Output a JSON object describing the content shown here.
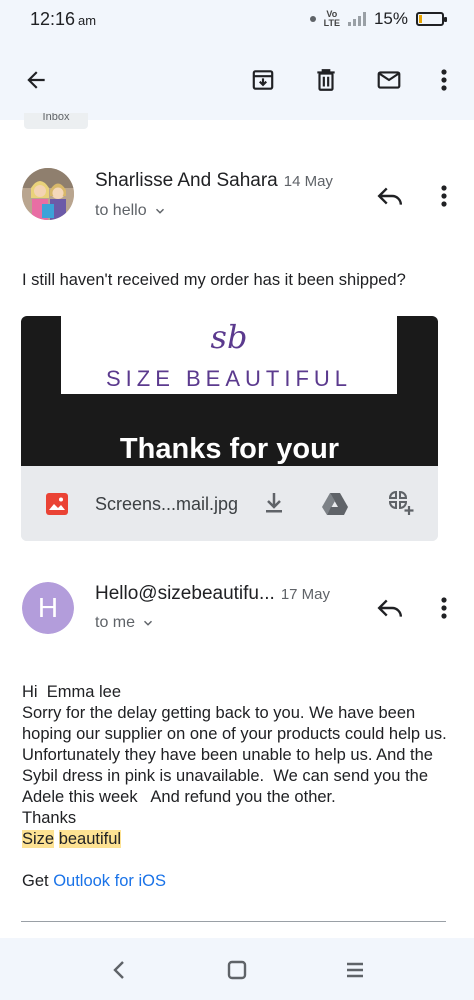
{
  "status_bar": {
    "time": "12:16",
    "ampm": "am",
    "network": "Vo LTE",
    "battery_text": "15%",
    "battery_level": 0.15
  },
  "toolbar": {
    "icons": [
      "back-arrow-icon",
      "archive-icon",
      "delete-icon",
      "mark-unread-icon",
      "more-vert-icon"
    ]
  },
  "label_chip": "Inbox",
  "message1": {
    "sender": "Sharlisse And Sahara",
    "date": "14 May",
    "recipient": "to hello",
    "body": "I still haven't received my order has it been shipped?",
    "attachment": {
      "file_name": "Screens...mail.jpg",
      "preview_logo_script": "sb",
      "preview_logo_text": "SIZE BEAUTIFUL",
      "preview_caption": "Thanks for your"
    }
  },
  "message2": {
    "avatar_letter": "H",
    "avatar_color": "#b39ddb",
    "sender": "Hello@sizebeautifu...",
    "date": "17 May",
    "recipient": "to me",
    "greeting": "Hi  Emma lee",
    "paragraph": "Sorry for the delay getting back to you. We have been hoping our supplier on one of your products could help us.  Unfortunately they have been unable to help us. And the Sybil dress in pink is unavailable.  We can send you the Adele this week   And refund you the other.",
    "thanks": "Thanks",
    "signature_word1": "Size",
    "signature_word2": "beautiful",
    "footer_prefix": "Get ",
    "footer_link": "Outlook for iOS"
  },
  "colors": {
    "accent": "#1a73e8",
    "highlight": "#fde293",
    "chrome": "#f2f6fc"
  }
}
